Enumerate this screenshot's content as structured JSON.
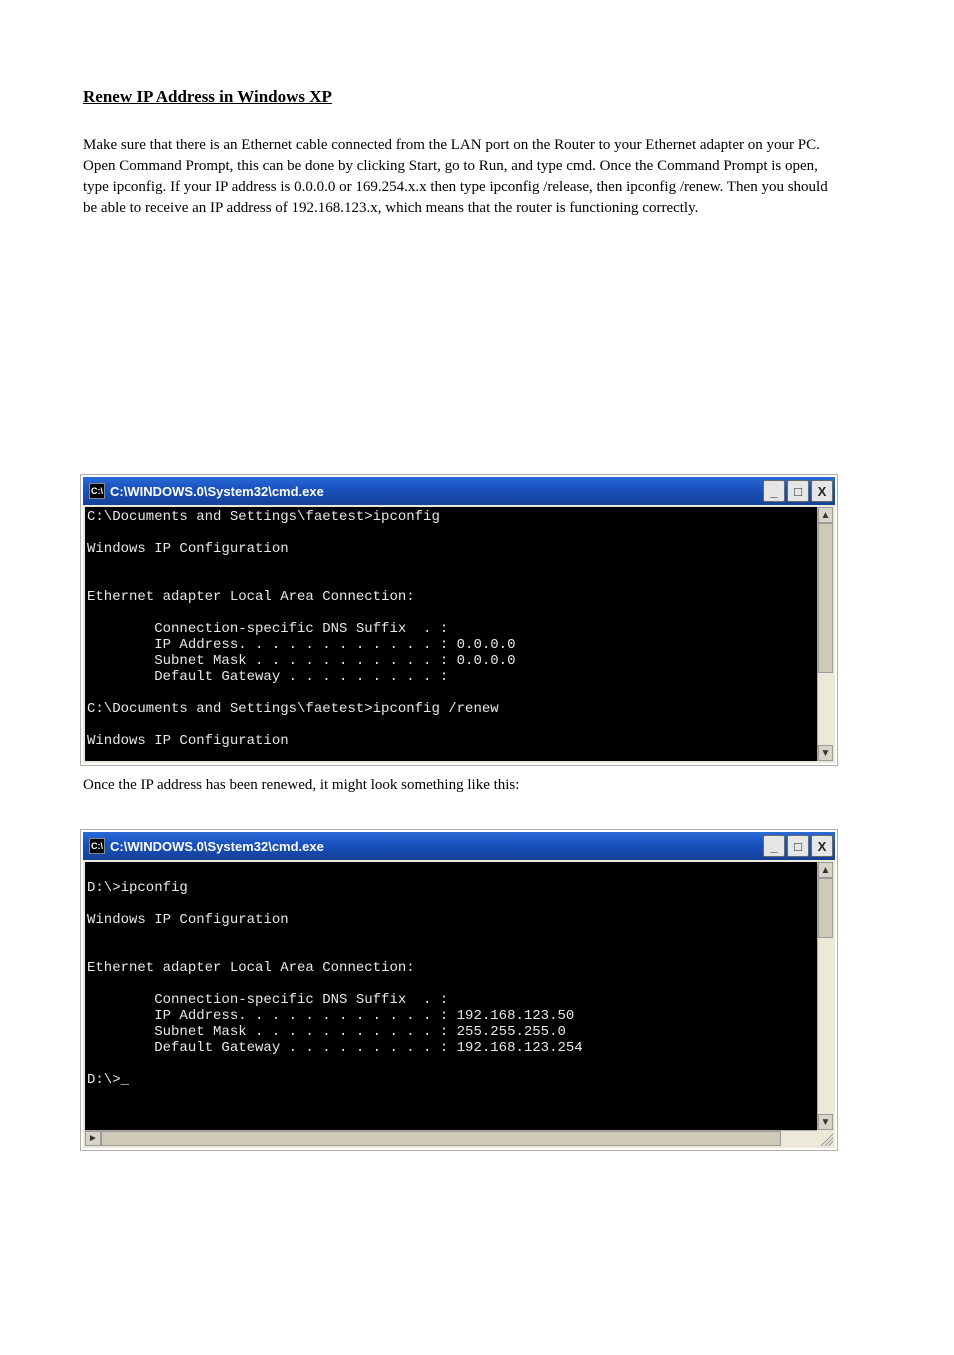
{
  "doc": {
    "heading": "Renew IP Address in Windows XP",
    "para1": "Make sure that there is an Ethernet cable connected from the LAN port on the Router to your Ethernet adapter on your PC. Open Command Prompt, this can be done by clicking Start, go to Run, and type cmd. Once the Command Prompt is open, type ipconfig. If your IP address is 0.0.0.0 or 169.254.x.x then type ipconfig /release, then ipconfig /renew. Then you should be able to receive an IP address of 192.168.123.x, which means that the router is functioning correctly.",
    "para2": "Once the IP address has been renewed, it might look something like this:"
  },
  "window1": {
    "title": "C:\\WINDOWS.0\\System32\\cmd.exe",
    "icon_label": "C:\\",
    "terminal_lines": [
      "C:\\Documents and Settings\\faetest>ipconfig",
      "",
      "Windows IP Configuration",
      "",
      "",
      "Ethernet adapter Local Area Connection:",
      "",
      "        Connection-specific DNS Suffix  . :",
      "        IP Address. . . . . . . . . . . . : 0.0.0.0",
      "        Subnet Mask . . . . . . . . . . . : 0.0.0.0",
      "        Default Gateway . . . . . . . . . :",
      "",
      "C:\\Documents and Settings\\faetest>ipconfig /renew",
      "",
      "Windows IP Configuration"
    ]
  },
  "window2": {
    "title": "C:\\WINDOWS.0\\System32\\cmd.exe",
    "icon_label": "C:\\",
    "terminal_lines": [
      "",
      "D:\\>ipconfig",
      "",
      "Windows IP Configuration",
      "",
      "",
      "Ethernet adapter Local Area Connection:",
      "",
      "        Connection-specific DNS Suffix  . :",
      "        IP Address. . . . . . . . . . . . : 192.168.123.50",
      "        Subnet Mask . . . . . . . . . . . : 255.255.255.0",
      "        Default Gateway . . . . . . . . . : 192.168.123.254",
      "",
      "D:\\>_"
    ]
  },
  "btn": {
    "min": "_",
    "max": "□",
    "close": "X",
    "up": "▲",
    "down": "▼",
    "left": "◄",
    "right": "►"
  }
}
